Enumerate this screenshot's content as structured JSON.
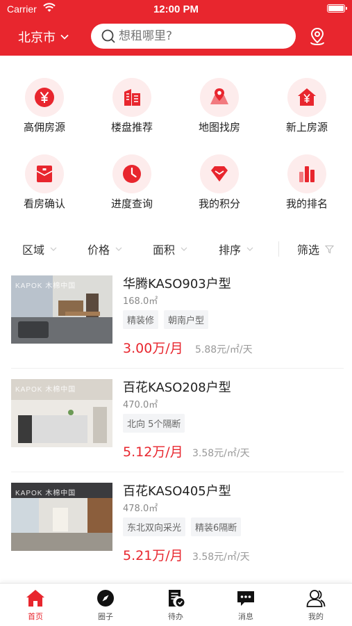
{
  "status_bar": {
    "carrier": "Carrier",
    "time": "12:00 PM"
  },
  "header": {
    "city": "北京市",
    "search_placeholder": "想租哪里?"
  },
  "quick_menu": [
    {
      "label": "高佣房源",
      "icon": "yen-coin-icon"
    },
    {
      "label": "楼盘推荐",
      "icon": "building-icon"
    },
    {
      "label": "地图找房",
      "icon": "map-pin-icon"
    },
    {
      "label": "新上房源",
      "icon": "new-house-icon"
    },
    {
      "label": "看房确认",
      "icon": "confirm-envelope-icon"
    },
    {
      "label": "进度查询",
      "icon": "clock-icon"
    },
    {
      "label": "我的积分",
      "icon": "diamond-icon"
    },
    {
      "label": "我的排名",
      "icon": "bar-chart-icon"
    }
  ],
  "filters": {
    "area": "区域",
    "price": "价格",
    "size": "面积",
    "sort": "排序",
    "filter": "筛选"
  },
  "listings": [
    {
      "title": "华腾KASO903户型",
      "area": "168.0㎡",
      "tags": [
        "精装修",
        "朝南户型"
      ],
      "price": "3.00万/月",
      "unit_price": "5.88元/㎡/天",
      "brand": "KAPOK 木棉中国"
    },
    {
      "title": "百花KASO208户型",
      "area": "470.0㎡",
      "tags": [
        "北向 5个隔断"
      ],
      "price": "5.12万/月",
      "unit_price": "3.58元/㎡/天",
      "brand": "KAPOK 木棉中国"
    },
    {
      "title": "百花KASO405户型",
      "area": "478.0㎡",
      "tags": [
        "东北双向采光",
        "精装6隔断"
      ],
      "price": "5.21万/月",
      "unit_price": "3.58元/㎡/天",
      "brand": "KAPOK 木棉中国"
    }
  ],
  "tabbar": [
    {
      "label": "首页",
      "icon": "home-icon",
      "active": true
    },
    {
      "label": "圈子",
      "icon": "compass-icon",
      "active": false
    },
    {
      "label": "待办",
      "icon": "todo-icon",
      "active": false
    },
    {
      "label": "消息",
      "icon": "message-icon",
      "active": false
    },
    {
      "label": "我的",
      "icon": "user-icon",
      "active": false
    }
  ],
  "colors": {
    "brand": "#e8262e",
    "icon_bg": "#fdecec",
    "tag_bg": "#f3f4f6"
  }
}
